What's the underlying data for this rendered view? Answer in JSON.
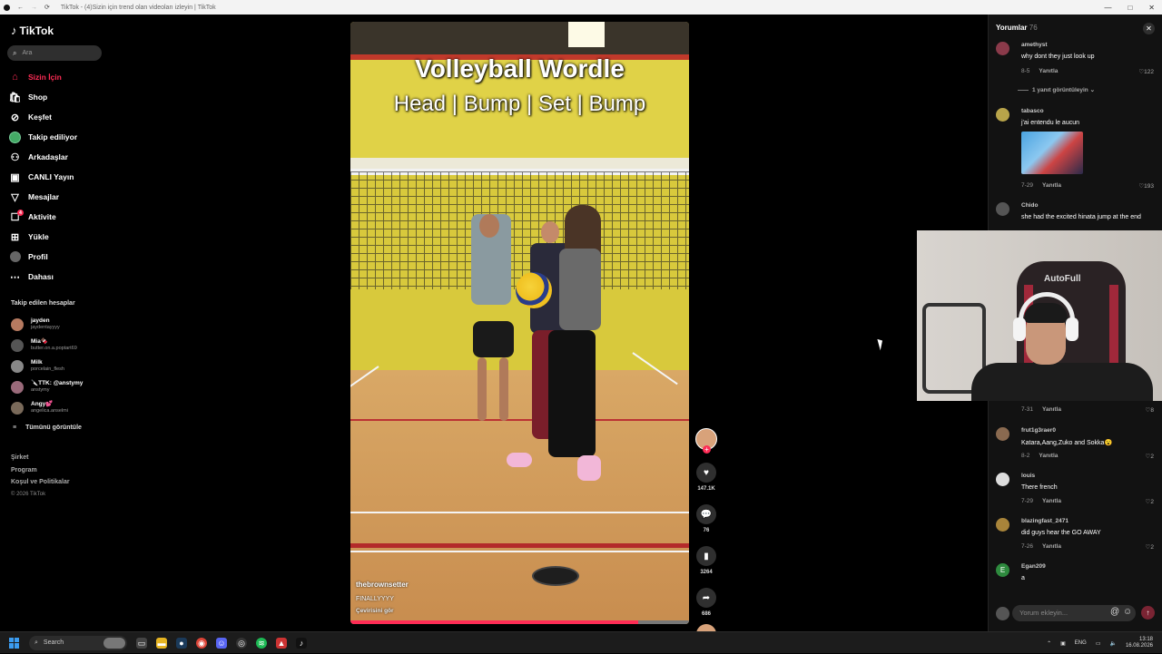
{
  "window": {
    "title": "TikTok - (4)Sizin için trend olan videoları izleyin | TikTok",
    "controls": [
      "—",
      "□",
      "✕"
    ]
  },
  "sidebar": {
    "logo": "TikTok",
    "search_placeholder": "Ara",
    "nav": [
      {
        "label": "Sizin İçin",
        "icon": "home-icon",
        "active": true
      },
      {
        "label": "Shop",
        "icon": "shop-icon"
      },
      {
        "label": "Keşfet",
        "icon": "compass-icon"
      },
      {
        "label": "Takip ediliyor",
        "icon": "following-avatar-icon"
      },
      {
        "label": "Arkadaşlar",
        "icon": "friends-icon"
      },
      {
        "label": "CANLI Yayın",
        "icon": "live-icon"
      },
      {
        "label": "Mesajlar",
        "icon": "messages-icon"
      },
      {
        "label": "Aktivite",
        "icon": "activity-icon",
        "badge": "4"
      },
      {
        "label": "Yükle",
        "icon": "upload-icon"
      },
      {
        "label": "Profil",
        "icon": "profile-icon"
      },
      {
        "label": "Dahası",
        "icon": "more-icon"
      }
    ],
    "following_title": "Takip edilen hesaplar",
    "following": [
      {
        "name": "jayden",
        "handle": "jaydentayyyy"
      },
      {
        "name": "Mia🍫",
        "handle": "butter.on.a.poptart69"
      },
      {
        "name": "Milk",
        "handle": "porcelain_flesh"
      },
      {
        "name": "🔪TTK: @anstymy",
        "handle": "anstymy"
      },
      {
        "name": "Angy💕",
        "handle": "angelica.anselmi"
      }
    ],
    "see_all": "Tümünü görüntüle",
    "footer_links": [
      "Şirket",
      "Program",
      "Koşul ve Politikalar"
    ],
    "copyright": "© 2026 TikTok"
  },
  "video": {
    "title": "Volleyball Wordle",
    "subtitle": "Head | Bump | Set | Bump",
    "author": "thebrownsetter",
    "caption": "FINALLYYYY",
    "translate": "Çevirisini gör",
    "progress": 0.85
  },
  "actions": {
    "likes": "147.1K",
    "comments": "76",
    "saves": "3264",
    "shares": "686"
  },
  "comments": {
    "title": "Yorumlar",
    "count": "76",
    "reply_label": "Yanıtla",
    "items": [
      {
        "user": "amethyst",
        "text": "why dont they just look up",
        "date": "8-5",
        "likes": "122"
      },
      {
        "user": "tabasco",
        "text": "j'ai entendu le aucun",
        "date": "7-29",
        "likes": "193"
      },
      {
        "user": "Chido",
        "text": "she had the excited hinata jump at the end",
        "date": "",
        "likes": ""
      },
      {
        "user": "",
        "text": "",
        "date": "7-31",
        "likes": "8"
      },
      {
        "user": "frut1g3raer0",
        "text": "Katara,Aang,Zuko and Sokka😮",
        "date": "8-2",
        "likes": "2"
      },
      {
        "user": "louis",
        "text": "There french",
        "date": "7-29",
        "likes": "2"
      },
      {
        "user": "blazingfast_2471",
        "text": "did guys hear the GO AWAY",
        "date": "7-26",
        "likes": "2"
      },
      {
        "user": "Egan209",
        "text": "a",
        "date": "",
        "likes": ""
      }
    ],
    "view_replies": "1 yanıt görüntüleyin",
    "input_placeholder": "Yorum ekleyin..."
  },
  "webcam": {
    "chair_brand": "AutoFull"
  },
  "taskbar": {
    "search_label": "Search",
    "lang": "ENG",
    "time": "13:18",
    "date": "16.08.2026"
  }
}
